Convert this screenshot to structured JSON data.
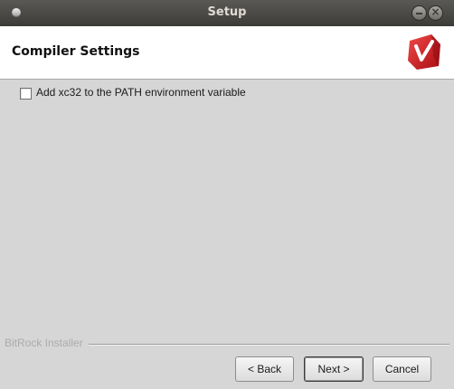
{
  "window": {
    "title": "Setup"
  },
  "header": {
    "title": "Compiler Settings",
    "logo_icon": "bitrock-logo-icon",
    "logo_color": "#d8181f"
  },
  "options": {
    "add_to_path": {
      "label": "Add xc32 to the PATH environment variable",
      "checked": false
    }
  },
  "footer": {
    "brand": "BitRock Installer"
  },
  "buttons": {
    "back_label": "< Back",
    "next_label": "Next >",
    "cancel_label": "Cancel"
  }
}
